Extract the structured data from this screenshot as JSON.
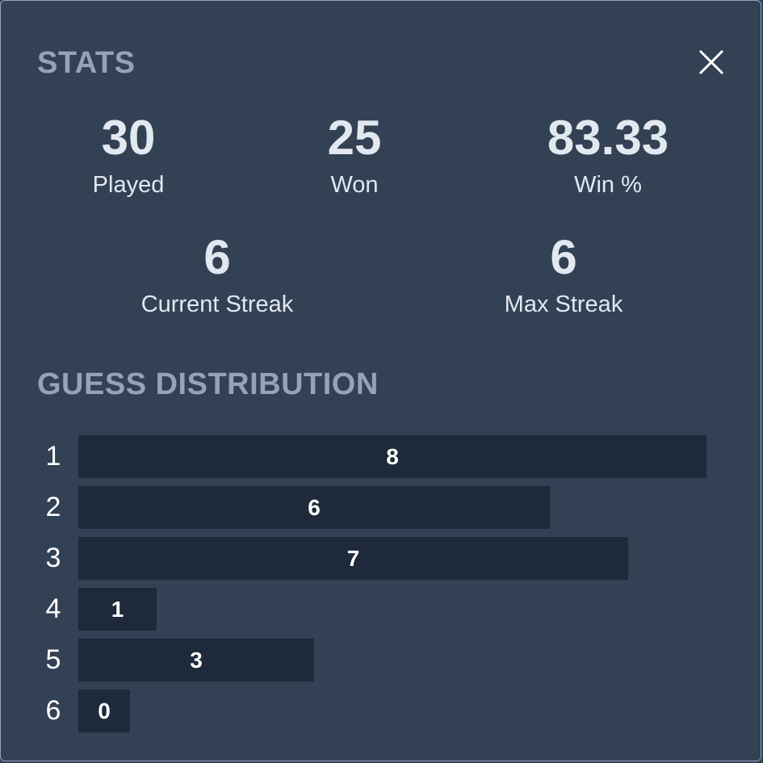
{
  "stats": {
    "title": "STATS",
    "items": [
      {
        "value": "30",
        "label": "Played"
      },
      {
        "value": "25",
        "label": "Won"
      },
      {
        "value": "83.33",
        "label": "Win %"
      },
      {
        "value": "6",
        "label": "Current Streak"
      },
      {
        "value": "6",
        "label": "Max Streak"
      }
    ]
  },
  "close": {
    "icon": "close-icon"
  },
  "distribution": {
    "title": "GUESS DISTRIBUTION",
    "rows": [
      {
        "guess": "1",
        "count": 8
      },
      {
        "guess": "2",
        "count": 6
      },
      {
        "guess": "3",
        "count": 7
      },
      {
        "guess": "4",
        "count": 1
      },
      {
        "guess": "5",
        "count": 3
      },
      {
        "guess": "6",
        "count": 0
      }
    ]
  },
  "colors": {
    "background": "#334155",
    "bar": "#1e293b",
    "heading": "#94a3b8",
    "text": "#e2e8f0"
  }
}
